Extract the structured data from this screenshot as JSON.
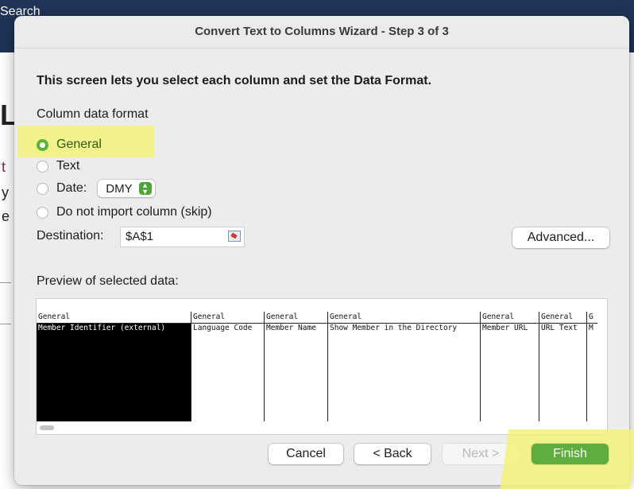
{
  "background": {
    "search_label": "Search",
    "glyphs": [
      "t",
      "y",
      "e",
      "L"
    ]
  },
  "dialog": {
    "title": "Convert Text to Columns Wizard - Step 3 of 3",
    "instructions": "This screen lets you select each column and set the Data Format.",
    "column_format_label": "Column data format",
    "options": [
      {
        "label": "General",
        "selected": true
      },
      {
        "label": "Text",
        "selected": false
      },
      {
        "label": "Date:",
        "selected": false
      },
      {
        "label": "Do not import column (skip)",
        "selected": false
      }
    ],
    "date_format": "DMY",
    "destination_label": "Destination:",
    "destination_value": "$A$1",
    "advanced_label": "Advanced...",
    "preview_label": "Preview of selected data:",
    "preview_columns": [
      {
        "header": "General",
        "value": "Member Identifier (external)",
        "selected": true
      },
      {
        "header": "General",
        "value": "Language Code",
        "selected": false
      },
      {
        "header": "General",
        "value": "Member Name",
        "selected": false
      },
      {
        "header": "General",
        "value": "Show Member in the Directory",
        "selected": false
      },
      {
        "header": "General",
        "value": "Member URL",
        "selected": false
      },
      {
        "header": "General",
        "value": "URL Text",
        "selected": false
      },
      {
        "header": "G",
        "value": "M",
        "selected": false
      }
    ],
    "buttons": {
      "cancel": "Cancel",
      "back": "< Back",
      "next": "Next >",
      "finish": "Finish"
    }
  },
  "colors": {
    "selected_radio": "#5fb13a",
    "finish_button": "#5fad3c",
    "highlight": "#f3f37a",
    "app_header": "#1f3457"
  }
}
